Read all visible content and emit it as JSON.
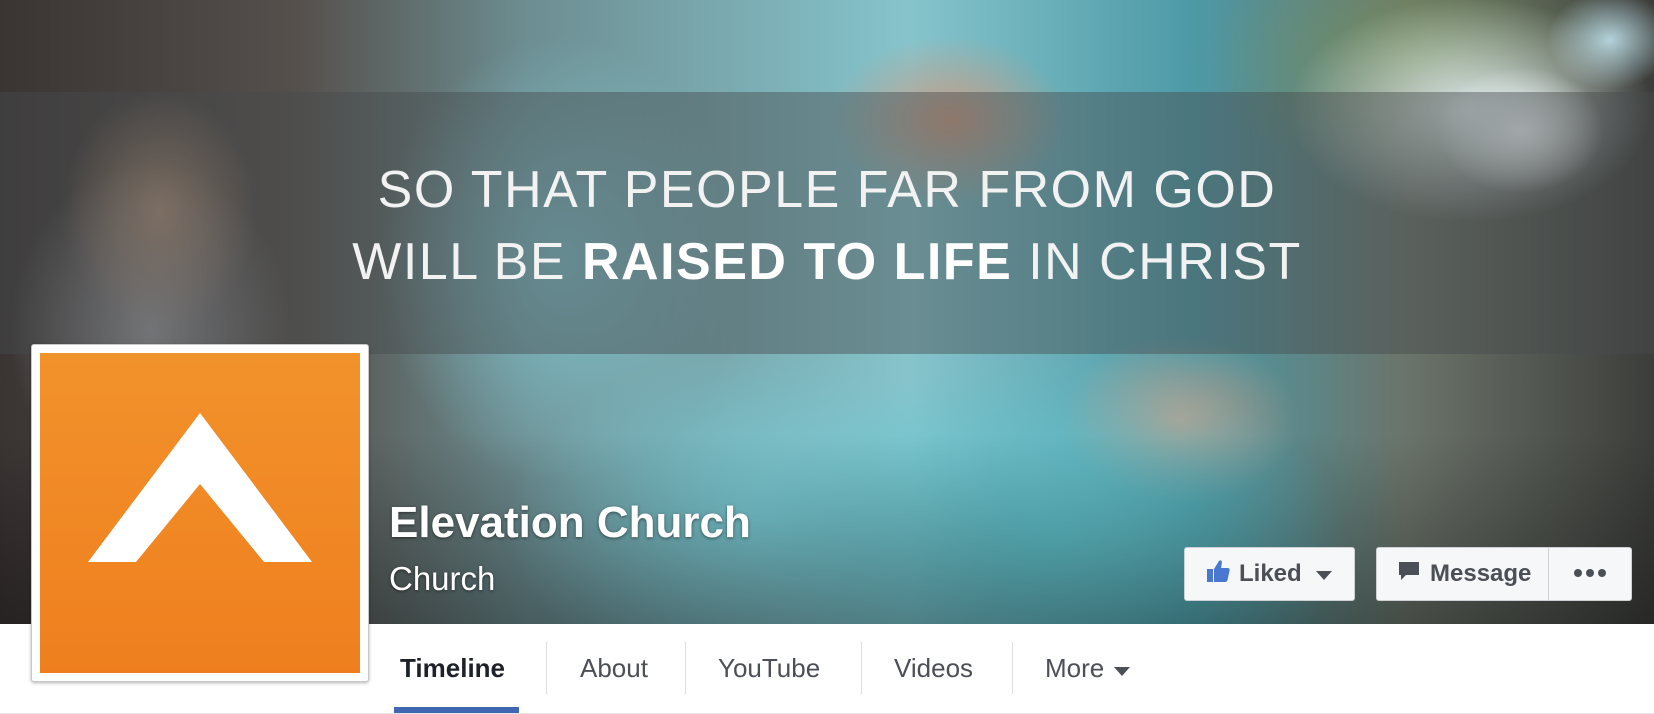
{
  "cover": {
    "tagline_line1": "SO THAT PEOPLE FAR FROM GOD",
    "tagline_line2_before": "WILL BE",
    "tagline_line2_bold": "RAISED TO LIFE",
    "tagline_line2_after": "IN CHRIST"
  },
  "profile": {
    "logo_icon": "elevation-chevron-logo",
    "logo_color": "#f18a24"
  },
  "page": {
    "name": "Elevation Church",
    "category": "Church"
  },
  "actions": {
    "liked_label": "Liked",
    "liked_icon": "thumbs-up-icon",
    "message_label": "Message",
    "message_icon": "speech-bubble-icon",
    "more_icon": "ellipsis-icon"
  },
  "tabs": [
    {
      "label": "Timeline",
      "active": true
    },
    {
      "label": "About"
    },
    {
      "label": "YouTube"
    },
    {
      "label": "Videos"
    },
    {
      "label": "More"
    }
  ],
  "colors": {
    "accent": "#4267b2",
    "like_blue": "#4a78d0"
  }
}
